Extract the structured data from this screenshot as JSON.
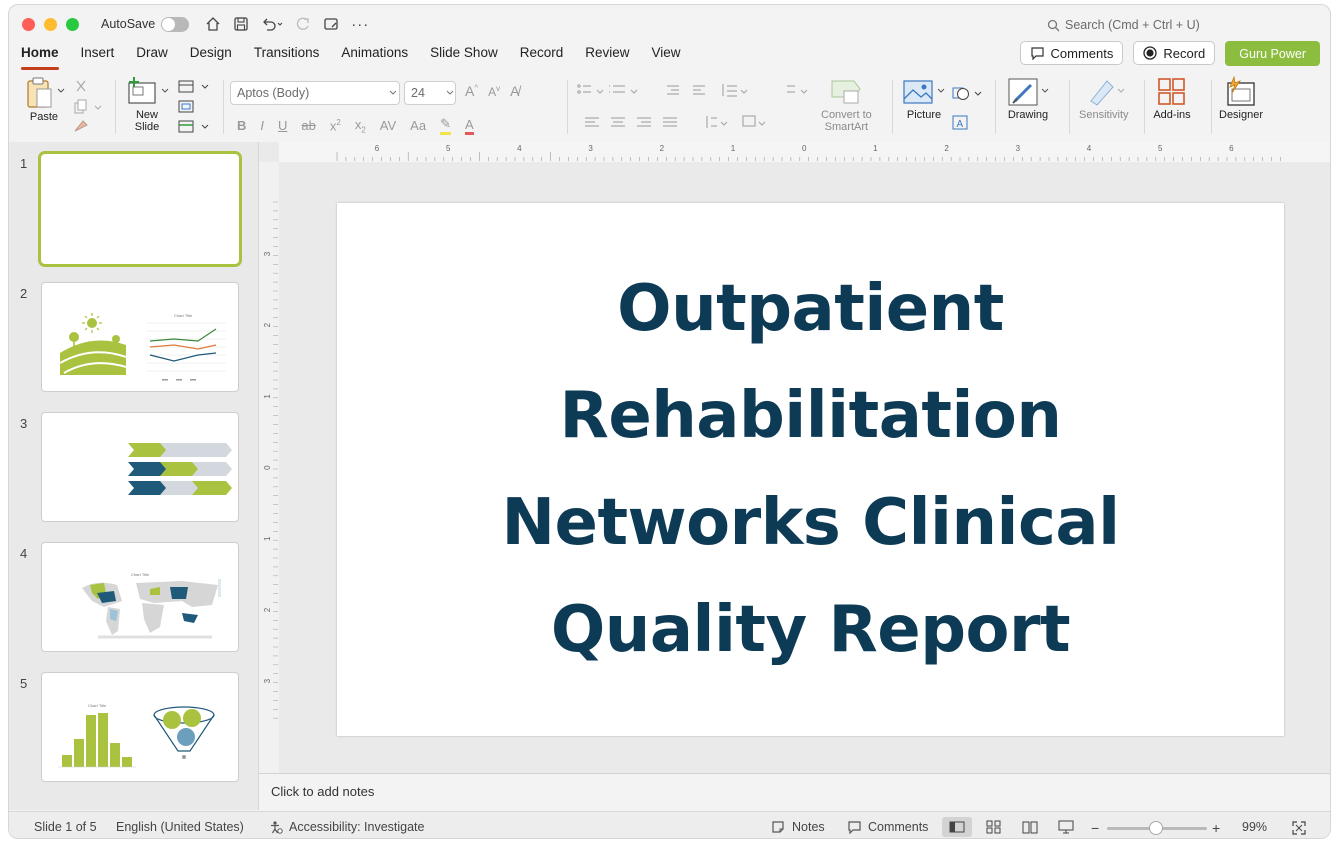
{
  "titlebar": {
    "autosave_label": "AutoSave",
    "search_placeholder": "Search (Cmd + Ctrl + U)"
  },
  "tabs": [
    {
      "label": "Home",
      "active": true
    },
    {
      "label": "Insert"
    },
    {
      "label": "Draw"
    },
    {
      "label": "Design"
    },
    {
      "label": "Transitions"
    },
    {
      "label": "Animations"
    },
    {
      "label": "Slide Show"
    },
    {
      "label": "Record"
    },
    {
      "label": "Review"
    },
    {
      "label": "View"
    }
  ],
  "header_right": {
    "comments_label": "Comments",
    "record_label": "Record",
    "guru_label": "Guru Power"
  },
  "ribbon": {
    "paste_label": "Paste",
    "new_slide_label": "New\nSlide",
    "font_name": "Aptos (Body)",
    "font_size": "24",
    "convert_smartart_label": "Convert to\nSmartArt",
    "picture_label": "Picture",
    "drawing_label": "Drawing",
    "sensitivity_label": "Sensitivity",
    "addins_label": "Add-ins",
    "designer_label": "Designer"
  },
  "slides": [
    {
      "number": "1",
      "selected": true
    },
    {
      "number": "2",
      "chart_title": "Chart Title"
    },
    {
      "number": "3"
    },
    {
      "number": "4",
      "chart_title": "Chart Title"
    },
    {
      "number": "5",
      "chart_title": "Chart Title"
    }
  ],
  "rulers": {
    "horizontal": [
      "6",
      "5",
      "4",
      "3",
      "2",
      "1",
      "0",
      "1",
      "2",
      "3",
      "4",
      "5",
      "6"
    ],
    "vertical": [
      "3",
      "2",
      "1",
      "0",
      "1",
      "2",
      "3"
    ]
  },
  "slide": {
    "title": "Outpatient Rehabilitation Networks Clinical Quality Report"
  },
  "notes_placeholder": "Click to add notes",
  "status": {
    "slide_info": "Slide 1 of 5",
    "language": "English (United States)",
    "accessibility": "Accessibility: Investigate",
    "notes_label": "Notes",
    "comments_label": "Comments",
    "zoom": "99%"
  },
  "colors": {
    "accent_red": "#c43e1c",
    "brand_green": "#8cbd3f",
    "title_navy": "#0d3a55"
  }
}
